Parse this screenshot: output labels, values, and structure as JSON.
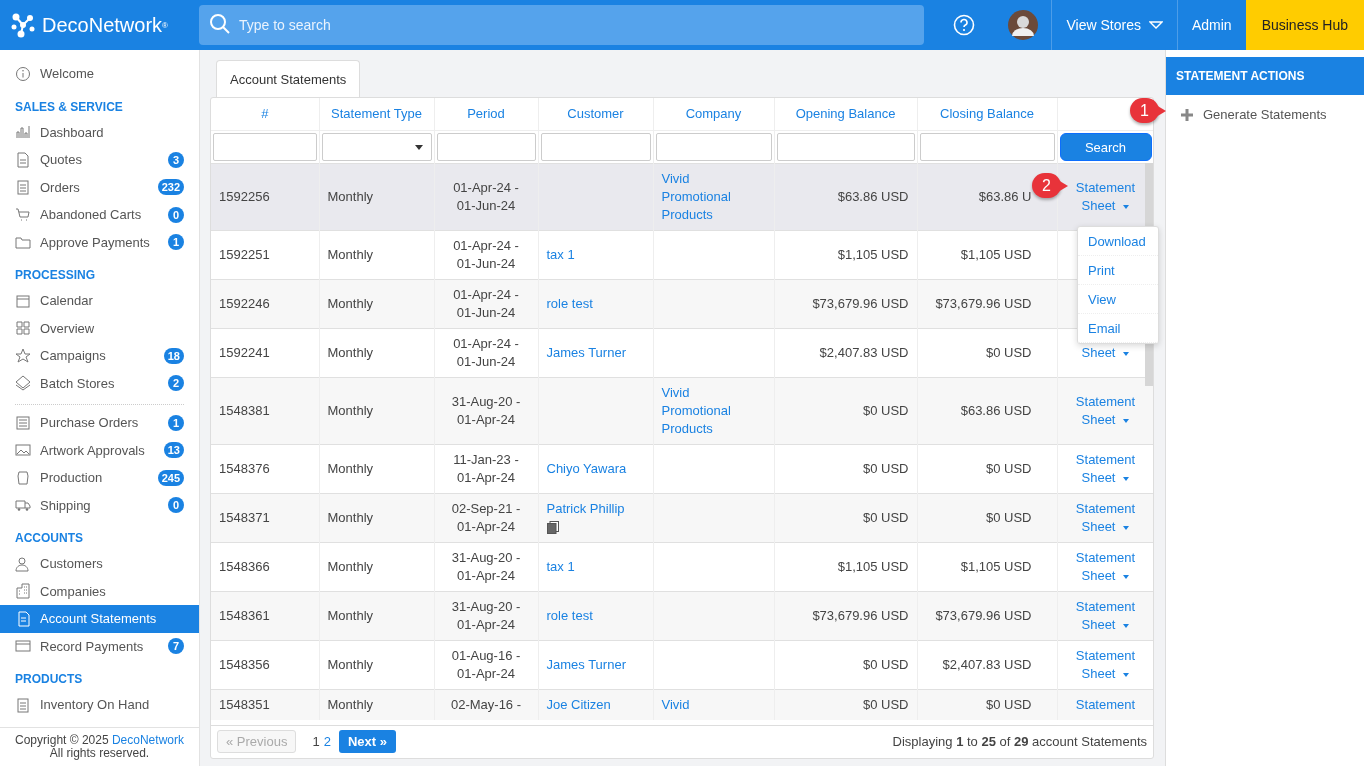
{
  "header": {
    "brand": "DecoNetwork",
    "brand_mark": "®",
    "search_placeholder": "Type to search",
    "view_stores": "View Stores",
    "admin": "Admin",
    "business_hub": "Business Hub"
  },
  "sidebar": {
    "groups": [
      {
        "items": [
          {
            "label": "Welcome",
            "selected": false
          }
        ]
      },
      {
        "heading": "SALES & SERVICE",
        "items": [
          {
            "label": "Dashboard",
            "selected": false
          },
          {
            "label": "Quotes",
            "badge": "3",
            "selected": false
          },
          {
            "label": "Orders",
            "badge": "232",
            "selected": false
          },
          {
            "label": "Abandoned Carts",
            "badge": "0",
            "selected": false
          },
          {
            "label": "Approve Payments",
            "badge": "1",
            "selected": false
          }
        ]
      },
      {
        "heading": "PROCESSING",
        "items": [
          {
            "label": "Calendar",
            "selected": false
          },
          {
            "label": "Overview",
            "selected": false
          },
          {
            "label": "Campaigns",
            "badge": "18",
            "selected": false
          },
          {
            "label": "Batch Stores",
            "badge": "2",
            "selected": false
          }
        ]
      },
      {
        "items": [
          {
            "label": "Purchase Orders",
            "badge": "1",
            "selected": false
          },
          {
            "label": "Artwork Approvals",
            "badge": "13",
            "selected": false
          },
          {
            "label": "Production",
            "badge": "245",
            "selected": false
          },
          {
            "label": "Shipping",
            "badge": "0",
            "selected": false
          }
        ]
      },
      {
        "heading": "ACCOUNTS",
        "items": [
          {
            "label": "Customers",
            "selected": false
          },
          {
            "label": "Companies",
            "selected": false
          },
          {
            "label": "Account Statements",
            "selected": true
          },
          {
            "label": "Record Payments",
            "badge": "7",
            "selected": false
          }
        ]
      },
      {
        "heading": "PRODUCTS",
        "items": [
          {
            "label": "Inventory On Hand",
            "selected": false
          }
        ]
      }
    ],
    "copyright": "Copyright © 2025 ",
    "copyright_link": "DecoNetwork",
    "rights": "All rights reserved."
  },
  "tab": "Account Statements",
  "table": {
    "columns": [
      "#",
      "Statement Type",
      "Period",
      "Customer",
      "Company",
      "Opening Balance",
      "Closing Balance"
    ],
    "search_button": "Search",
    "rows": [
      {
        "id": "1592256",
        "type": "Monthly",
        "period": [
          "01-Apr-24 -",
          "01-Jun-24"
        ],
        "company": "Vivid Promotional Products",
        "opening": "$63.86 USD",
        "closing": "$63.86 U",
        "action": "Statement Sheet",
        "dropdown": true,
        "selected": true,
        "menu": [
          "Download",
          "Print",
          "View",
          "Email"
        ]
      },
      {
        "id": "1592251",
        "type": "Monthly",
        "period": [
          "01-Apr-24 -",
          "01-Jun-24"
        ],
        "customer": "tax 1",
        "opening": "$1,105 USD",
        "closing": "$1,105 USD",
        "selected": false
      },
      {
        "id": "1592246",
        "type": "Monthly",
        "period": [
          "01-Apr-24 -",
          "01-Jun-24"
        ],
        "customer": "role test",
        "opening": "$73,679.96 USD",
        "closing": "$73,679.96 USD",
        "selected": false
      },
      {
        "id": "1592241",
        "type": "Monthly",
        "period": [
          "01-Apr-24 -",
          "01-Jun-24"
        ],
        "customer": "James Turner",
        "opening": "$2,407.83 USD",
        "closing": "$0 USD",
        "action": "Sheet",
        "dropdown": true,
        "selected": false
      },
      {
        "id": "1548381",
        "type": "Monthly",
        "period": [
          "31-Aug-20 -",
          "01-Apr-24"
        ],
        "company": "Vivid Promotional Products",
        "opening": "$0 USD",
        "closing": "$63.86 USD",
        "action": "Statement Sheet",
        "dropdown": true,
        "selected": false
      },
      {
        "id": "1548376",
        "type": "Monthly",
        "period": [
          "11-Jan-23 -",
          "01-Apr-24"
        ],
        "customer": "Chiyo Yawara",
        "opening": "$0 USD",
        "closing": "$0 USD",
        "action": "Statement Sheet",
        "dropdown": true,
        "selected": false
      },
      {
        "id": "1548371",
        "type": "Monthly",
        "period": [
          "02-Sep-21 -",
          "01-Apr-24"
        ],
        "customer": "Patrick Phillip",
        "copy_icon": true,
        "opening": "$0 USD",
        "closing": "$0 USD",
        "action": "Statement Sheet",
        "dropdown": true,
        "selected": false
      },
      {
        "id": "1548366",
        "type": "Monthly",
        "period": [
          "31-Aug-20 -",
          "01-Apr-24"
        ],
        "customer": "tax 1",
        "opening": "$1,105 USD",
        "closing": "$1,105 USD",
        "action": "Statement Sheet",
        "dropdown": true,
        "selected": false
      },
      {
        "id": "1548361",
        "type": "Monthly",
        "period": [
          "31-Aug-20 -",
          "01-Apr-24"
        ],
        "customer": "role test",
        "opening": "$73,679.96 USD",
        "closing": "$73,679.96 USD",
        "action": "Statement Sheet",
        "dropdown": true,
        "selected": false
      },
      {
        "id": "1548356",
        "type": "Monthly",
        "period": [
          "01-Aug-16 -",
          "01-Apr-24"
        ],
        "customer": "James Turner",
        "opening": "$0 USD",
        "closing": "$2,407.83 USD",
        "action": "Statement Sheet",
        "dropdown": true,
        "selected": false
      },
      {
        "id": "1548351",
        "type": "Monthly",
        "period": [
          "02-May-16 -"
        ],
        "customer": "Joe Citizen",
        "company": "Vivid",
        "opening": "$0 USD",
        "closing": "$0 USD",
        "action": "Statement",
        "dropdown": false,
        "selected": false
      }
    ],
    "pagination": {
      "previous": "« Previous",
      "pages": [
        {
          "label": "1",
          "selected": true
        },
        {
          "label": "2",
          "selected": false
        }
      ],
      "next": "Next »",
      "summary": "Displaying **1** to **25** of **29** account Statements"
    }
  },
  "actions_panel": {
    "title": "STATEMENT ACTIONS",
    "items": [
      "Generate Statements"
    ]
  },
  "callouts": [
    {
      "label": "1"
    },
    {
      "label": "2"
    }
  ]
}
